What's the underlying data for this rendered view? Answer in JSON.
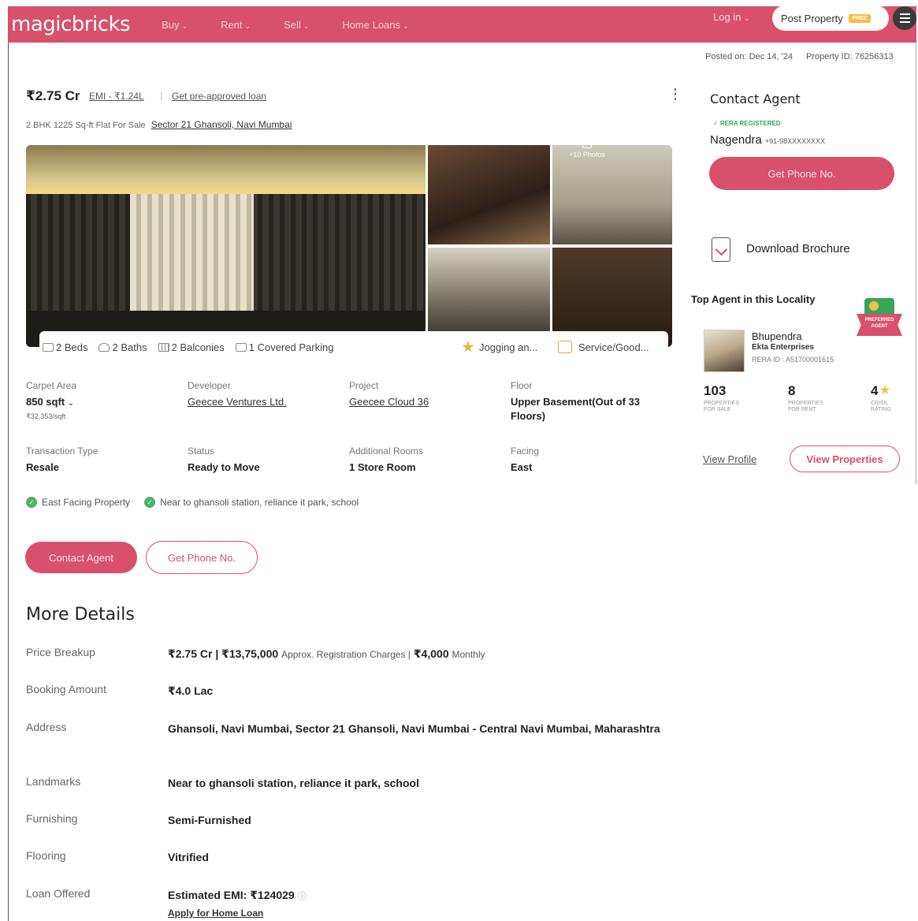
{
  "header": {
    "logo": "magicbricks",
    "nav": [
      {
        "label": "Buy"
      },
      {
        "label": "Rent"
      },
      {
        "label": "Sell"
      },
      {
        "label": "Home Loans"
      }
    ],
    "login": "Log in",
    "post_property": "Post Property",
    "free_badge": "FREE"
  },
  "meta": {
    "posted_on": "Posted on: Dec 14, '24",
    "property_id": "Property ID: 76256313"
  },
  "listing": {
    "price": "₹2.75 Cr",
    "emi": "EMI - ₹1.24L",
    "preapproved": "Get pre-approved loan",
    "subtitle": "2 BHK 1225 Sq-ft Flat For Sale",
    "locality": "Sector 21 Ghansoli, Navi Mumbai",
    "more_photos": "+10 Photos"
  },
  "amenities": {
    "beds": "2 Beds",
    "baths": "2 Baths",
    "balconies": "2 Balconies",
    "parking": "1 Covered Parking",
    "jogging": "Jogging an...",
    "service": "Service/Good..."
  },
  "specs": {
    "carpet_label": "Carpet Area",
    "carpet_value": "850 sqft",
    "carpet_rate": "₹32,353/sqft",
    "developer_label": "Developer",
    "developer_value": "Geecee Ventures Ltd.",
    "project_label": "Project",
    "project_value": "Geecee Cloud 36",
    "floor_label": "Floor",
    "floor_value": "Upper Basement(Out of 33 Floors)",
    "transaction_label": "Transaction Type",
    "transaction_value": "Resale",
    "status_label": "Status",
    "status_value": "Ready to Move",
    "rooms_label": "Additional Rooms",
    "rooms_value": "1 Store Room",
    "facing_label": "Facing",
    "facing_value": "East"
  },
  "highlights": [
    "East Facing Property",
    "Near to ghansoli station, reliance it park, school"
  ],
  "actions": {
    "contact_agent": "Contact Agent",
    "get_phone": "Get Phone No."
  },
  "more_details": {
    "title": "More Details",
    "price_breakup_label": "Price Breakup",
    "price_breakup_value": "₹2.75 Cr | ₹13,75,000",
    "price_breakup_reg": "Approx. Registration Charges |",
    "price_breakup_monthly_value": "₹4,000",
    "price_breakup_monthly": "Monthly",
    "booking_label": "Booking Amount",
    "booking_value": "₹4.0 Lac",
    "address_label": "Address",
    "address_value": "Ghansoli, Navi Mumbai, Sector 21 Ghansoli, Navi Mumbai - Central Navi Mumbai, Maharashtra",
    "landmarks_label": "Landmarks",
    "landmarks_value": "Near to ghansoli station, reliance it park, school",
    "furnishing_label": "Furnishing",
    "furnishing_value": "Semi-Furnished",
    "flooring_label": "Flooring",
    "flooring_value": "Vitrified",
    "loan_label": "Loan Offered",
    "loan_value": "Estimated EMI: ₹124029",
    "apply_loan": "Apply for Home Loan"
  },
  "contact_panel": {
    "title": "Contact Agent",
    "rera": "RERA REGISTERED",
    "agent_name": "Nagendra",
    "agent_phone": "+91-98XXXXXXXX",
    "get_phone": "Get Phone No.",
    "brochure": "Download Brochure"
  },
  "top_agent": {
    "title": "Top Agent in this Locality",
    "badge": "PREFERRED AGENT",
    "name": "Bhupendra",
    "firm": "Ekta Enterprises",
    "rera_id": "RERA ID : A51700001615",
    "stat_sale_num": "103",
    "stat_sale_cap": "PROPERTIES FOR SALE",
    "stat_rent_num": "8",
    "stat_rent_cap": "PROPERTIES FOR RENT",
    "stat_rating_num": "4",
    "stat_rating_cap": "CRISIL RATING",
    "view_profile": "View Profile",
    "view_properties": "View Properties"
  },
  "colors": {
    "brand": "#d8506b",
    "success": "#4db36b",
    "star": "#f0c040"
  }
}
